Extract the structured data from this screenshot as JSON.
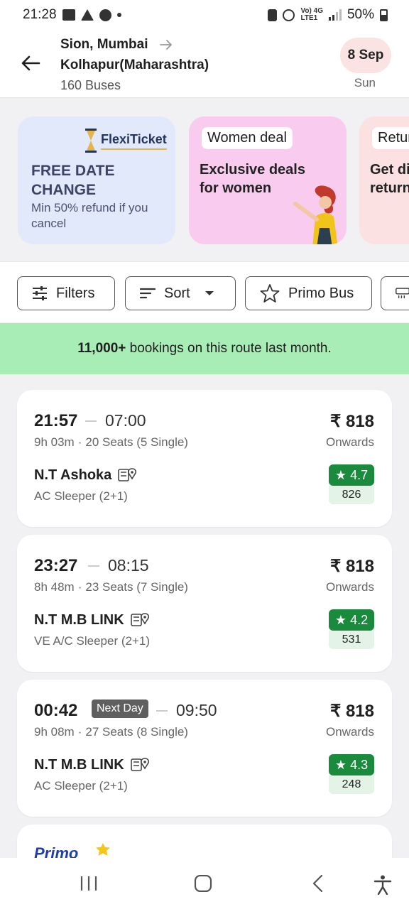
{
  "status": {
    "time": "21:28",
    "network_top": "Vo) 4G",
    "network_bottom": "LTE1",
    "battery": "50%"
  },
  "header": {
    "from": "Sion, Mumbai",
    "to": "Kolhapur(Maharashtra)",
    "bus_count": "160 Buses",
    "date": "8 Sep",
    "day": "Sun"
  },
  "offers": {
    "flexi": {
      "brand": "FlexiTicket",
      "title_line1": "FREE DATE",
      "title_line2": "CHANGE",
      "subtitle": "Min 50% refund if you cancel"
    },
    "women": {
      "tag": "Women deal",
      "title_line1": "Exclusive deals",
      "title_line2": "for women"
    },
    "return": {
      "tag": "Retur",
      "title_line1": "Get dis",
      "title_line2": "return"
    }
  },
  "filters": {
    "filters_label": "Filters",
    "sort_label": "Sort",
    "primo_label": "Primo Bus"
  },
  "banner": {
    "highlight": "11,000+",
    "text": " bookings on this route last month."
  },
  "buses": [
    {
      "departure": "21:57",
      "arrival": "07:00",
      "duration": "9h 03m",
      "seats": "20 Seats (5 Single)",
      "price": "₹ 818",
      "price_note": "Onwards",
      "operator": "N.T Ashoka",
      "bus_type": "AC Sleeper (2+1)",
      "rating": "4.7",
      "rating_count": "826"
    },
    {
      "departure": "23:27",
      "arrival": "08:15",
      "duration": "8h 48m",
      "seats": "23 Seats (7 Single)",
      "price": "₹ 818",
      "price_note": "Onwards",
      "operator": "N.T M.B LINK",
      "bus_type": "VE A/C Sleeper (2+1)",
      "rating": "4.2",
      "rating_count": "531"
    },
    {
      "departure": "00:42",
      "next_day": "Next Day",
      "arrival": "09:50",
      "duration": "9h 08m",
      "seats": "27 Seats (8 Single)",
      "price": "₹ 818",
      "price_note": "Onwards",
      "operator": "N.T M.B LINK",
      "bus_type": "AC Sleeper (2+1)",
      "rating": "4.3",
      "rating_count": "248"
    }
  ],
  "partial_card": {
    "logo_text": "Primo"
  },
  "colors": {
    "rating_green": "#1a8a3d",
    "banner_green": "#a9edb6",
    "date_chip": "#fbe3e3"
  },
  "rating_star": "★"
}
